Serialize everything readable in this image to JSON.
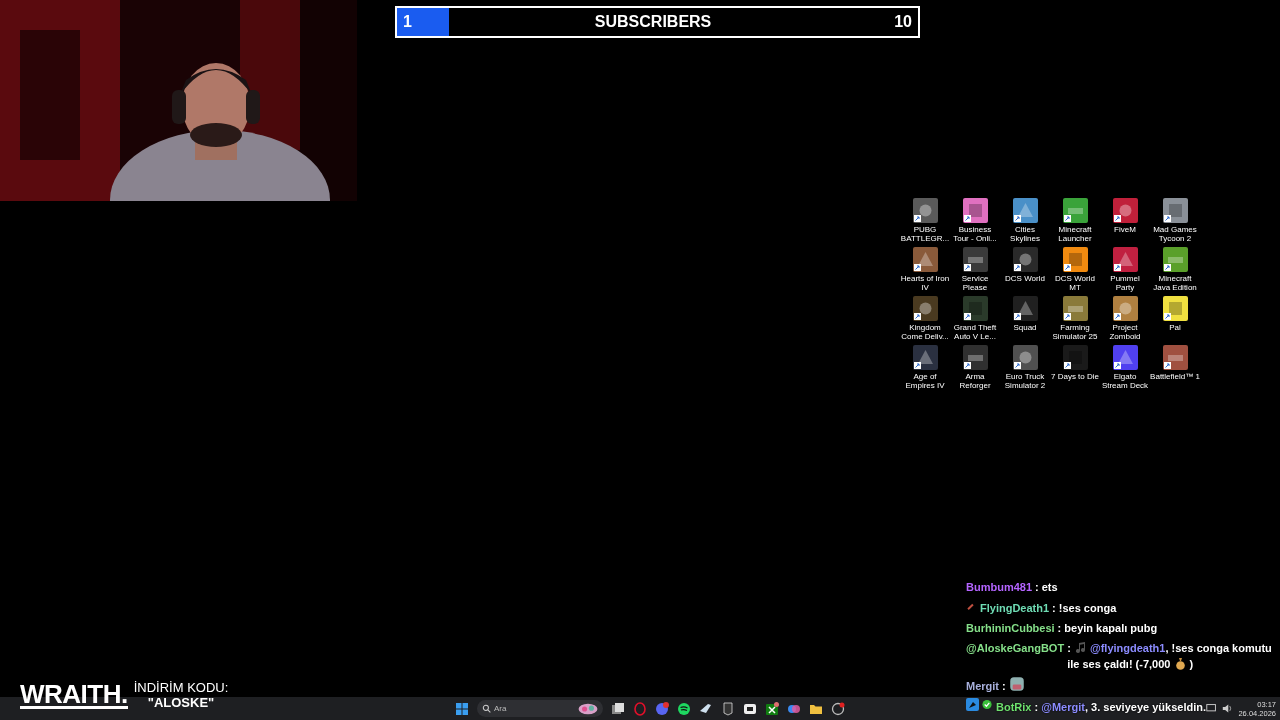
{
  "subscriber_goal": {
    "current": "1",
    "title": "SUBSCRIBERS",
    "target": "10",
    "level": 0.1
  },
  "desktop_icons": [
    {
      "label": "PUBG BATTLEGR...",
      "color": "#5a5a5a"
    },
    {
      "label": "Business Tour - Onli...",
      "color": "#e070c0"
    },
    {
      "label": "Cities Skylines",
      "color": "#4a90c8"
    },
    {
      "label": "Minecraft Launcher",
      "color": "#3aa33a"
    },
    {
      "label": "FiveM",
      "color": "#c0203a"
    },
    {
      "label": "Mad Games Tycoon 2",
      "color": "#8a9098"
    },
    {
      "label": "Hearts of Iron IV",
      "color": "#8a5a3a"
    },
    {
      "label": "Service Please",
      "color": "#3a3a3a"
    },
    {
      "label": "DCS World",
      "color": "#2a2a2a"
    },
    {
      "label": "DCS World MT",
      "color": "#f08a10"
    },
    {
      "label": "Pummel Party",
      "color": "#c02040"
    },
    {
      "label": "Minecraft Java Edition",
      "color": "#5aa02a"
    },
    {
      "label": "Kingdom Come Deliv...",
      "color": "#4a3a20"
    },
    {
      "label": "Grand Theft Auto V Le...",
      "color": "#2a3a2a"
    },
    {
      "label": "Squad",
      "color": "#202020"
    },
    {
      "label": "Farming Simulator 25",
      "color": "#8a7a3a"
    },
    {
      "label": "Project Zomboid",
      "color": "#b08040"
    },
    {
      "label": "Pal",
      "color": "#f0e040"
    },
    {
      "label": "Age of Empires IV",
      "color": "#2a3040"
    },
    {
      "label": "Arma Reforger",
      "color": "#303030"
    },
    {
      "label": "Euro Truck Simulator 2",
      "color": "#505050"
    },
    {
      "label": "7 Days to Die",
      "color": "#1a1a1a"
    },
    {
      "label": "Elgato Stream Deck",
      "color": "#5040f0"
    },
    {
      "label": "Battlefield™ 1",
      "color": "#a05040"
    }
  ],
  "chat": [
    {
      "user": "Bumbum481",
      "color": "#b464ff",
      "parts": [
        {
          "kind": "plain",
          "text": ": ets"
        }
      ]
    },
    {
      "user": "FlyingDeath1",
      "color": "#6fdcb4",
      "badges": [
        {
          "kind": "sword"
        }
      ],
      "parts": [
        {
          "kind": "plain",
          "text": ": !ses conga"
        }
      ]
    },
    {
      "user": "BurhininCubbesi",
      "color": "#86e08a",
      "parts": [
        {
          "kind": "plain",
          "text": ": beyin kapalı pubg"
        }
      ]
    },
    {
      "user": "@AloskeGangBOT",
      "color": "#86e08a",
      "parts": [
        {
          "kind": "plain",
          "text": ": "
        },
        {
          "kind": "note"
        },
        {
          "kind": "mention",
          "text": "@flyingdeath1"
        },
        {
          "kind": "plain",
          "text": ", !ses conga komutu ile ses çaldı! (-7,000 "
        },
        {
          "kind": "bag"
        },
        {
          "kind": "plain",
          "text": " )"
        }
      ]
    },
    {
      "user": "Mergit",
      "color": "#a8b0dc",
      "parts": [
        {
          "kind": "plain",
          "text": ": "
        },
        {
          "kind": "face"
        }
      ]
    },
    {
      "user": "BotRix",
      "color": "#6ee06e",
      "badges": [
        {
          "kind": "bot"
        },
        {
          "kind": "verified"
        }
      ],
      "parts": [
        {
          "kind": "plain",
          "text": ": "
        },
        {
          "kind": "mention",
          "text": "@Mergit"
        },
        {
          "kind": "plain",
          "text": ", 3. seviyeye yükseldin."
        }
      ]
    }
  ],
  "sponsor": {
    "brand": "WRAITH.",
    "code_label": "İNDİRİM KODU:",
    "code": "\"ALOSKE\""
  },
  "taskbar": {
    "search_placeholder": "Ara",
    "clock": {
      "time": "03:17",
      "date": "26.04.2026"
    }
  }
}
